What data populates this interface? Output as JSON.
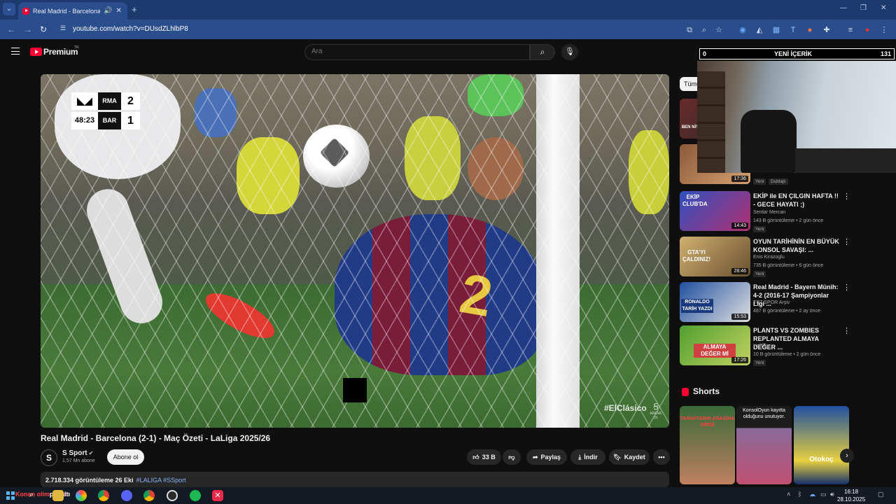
{
  "browser": {
    "tab_title": "Real Madrid - Barcelona (2-1) - Maç Özeti - LaLiga 2025/26",
    "url": "youtube.com/watch?v=DUsdZLhlbP8"
  },
  "header": {
    "brand": "Premium",
    "region": "TR",
    "search_placeholder": "Ara"
  },
  "video": {
    "scorebug": {
      "home_team": "RMA",
      "away_team": "BAR",
      "home_score": "2",
      "away_score": "1",
      "clock": "48:23"
    },
    "watermark": "#ElClásico",
    "arena_mark": "ARENE OL",
    "title": "Real Madrid - Barcelona (2-1) - Maç Özeti - LaLiga 2025/26",
    "channel": "S Sport",
    "channel_avatar": "S",
    "subscribers": "1,57 Mn abone",
    "subscribe_label": "Abone ol",
    "likes": "33 B",
    "share_label": "Paylaş",
    "download_label": "İndir",
    "save_label": "Kaydet",
    "views_date": "2.718.334 görüntüleme  26 Eki",
    "tags": "#LALIGA #SSport"
  },
  "sidebar": {
    "chip_all": "Tümü",
    "recommendations": [
      {
        "thumb_text": "BEN NİYE",
        "duration": "",
        "title": "",
        "channel": "",
        "meta": "",
        "badge": ""
      },
      {
        "thumb_text": "",
        "duration": "17:36",
        "title": "",
        "channel": "",
        "meta": "",
        "badge": "Yeni",
        "badge2": "Dublajlı"
      },
      {
        "thumb_text": "EKİP CLUB'DA",
        "duration": "14:43",
        "title": "EKİP ile EN ÇILGIN HAFTA !! - GECE HAYATI ;)",
        "channel": "Serdar Mercan",
        "meta": "143 B görüntüleme • 2 gün önce",
        "badge": "Yeni"
      },
      {
        "thumb_text": "GTA'YI ÇALDINIZ!",
        "duration": "28:46",
        "title": "OYUN TARİHİNİN EN BÜYÜK KONSOL SAVAŞI: ...",
        "channel": "Enis Kirazoglu",
        "meta": "735 B görüntüleme • 6 gün önce",
        "badge": "Yeni"
      },
      {
        "thumb_text": "RONALDO TARİH YAZDI",
        "duration": "15:53",
        "title": "Real Madrid - Bayern Münih: 4-2 (2016-17 Şampiyonlar Ligi ...",
        "channel": "TRT SPOR Arşiv",
        "meta": "487 B görüntüleme • 2 ay önce",
        "badge": ""
      },
      {
        "thumb_text": "ALMAYA DEĞER Mİ",
        "duration": "17:26",
        "title": "PLANTS VS ZOMBIES REPLANTED ALMAYA DEĞER ...",
        "channel": "HelTegr",
        "meta": "10 B görüntüleme • 2 gün önce",
        "badge": "Yeni"
      }
    ],
    "shorts_title": "Shorts",
    "shorts": [
      {
        "text": "TARAFTARIN ARASINA GİRDİ"
      },
      {
        "text": "KonsolOyun kayıtta olduğunu unutuyor."
      },
      {
        "text": "Otokoç"
      }
    ]
  },
  "stream_overlay": {
    "left_count": "0",
    "label": "YENİ İÇERİK",
    "right_count": "131"
  },
  "taskbar": {
    "search_label": "Konan olimpiadar",
    "search_text": "penaltı",
    "time": "16:18",
    "date": "28.10.2025"
  }
}
